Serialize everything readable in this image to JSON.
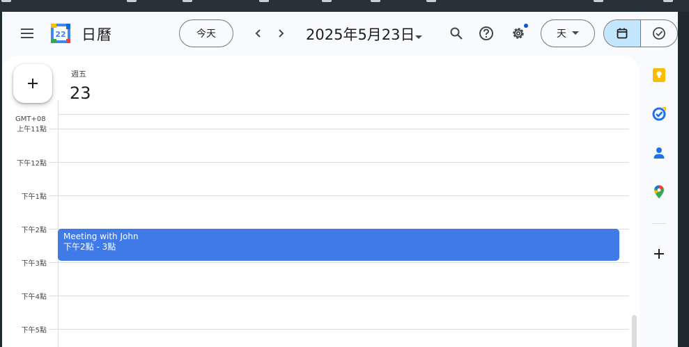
{
  "header": {
    "app_name": "日曆",
    "logo_day": "22",
    "today_label": "今天",
    "date_title": "2025年5月23日",
    "view_label": "天"
  },
  "day_header": {
    "weekday": "週五",
    "day_number": "23"
  },
  "timezone": "GMT+08",
  "hours": [
    "上午11點",
    "下午12點",
    "下午1點",
    "下午2點",
    "下午3點",
    "下午4點",
    "下午5點"
  ],
  "event": {
    "title": "Meeting with John",
    "time": "下午2點 - 3點",
    "color": "#3f7ae6"
  },
  "side_panel": {
    "icons": [
      "keep-icon",
      "tasks-icon",
      "contacts-icon",
      "maps-icon",
      "add-icon"
    ]
  },
  "colors": {
    "accent": "#0b57d0",
    "toggle_active": "#c2e7ff"
  }
}
